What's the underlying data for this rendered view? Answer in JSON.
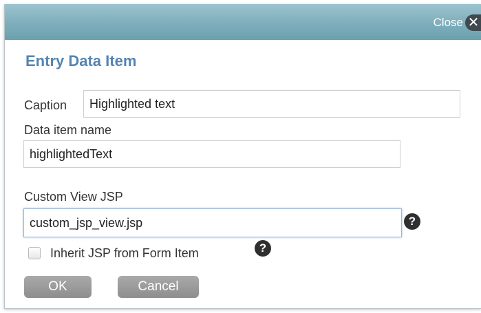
{
  "titlebar": {
    "close_label": "Close",
    "close_icon": "close-x-icon"
  },
  "dialog": {
    "title": "Entry Data Item"
  },
  "form": {
    "caption_label": "Caption",
    "caption_value": "Highlighted text",
    "data_item_name_label": "Data item name",
    "data_item_name_value": "highlightedText",
    "custom_view_jsp_label": "Custom View JSP",
    "custom_view_jsp_value": "custom_jsp_view.jsp",
    "inherit_label": "Inherit JSP from Form Item",
    "inherit_checked": false,
    "help_glyph": "?"
  },
  "buttons": {
    "ok_label": "OK",
    "cancel_label": "Cancel"
  },
  "colors": {
    "titlebar": "#7eaebc",
    "title_text": "#5485b0",
    "button": "#9b9b9b"
  }
}
